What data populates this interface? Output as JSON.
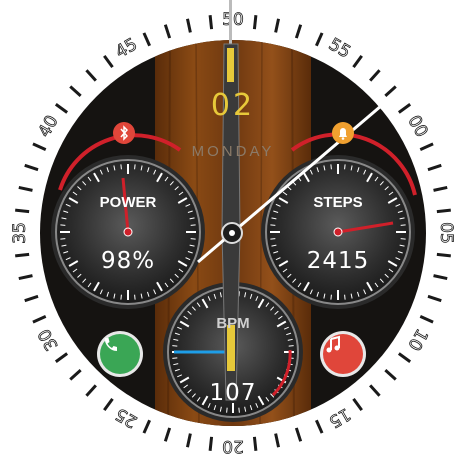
{
  "bezel": {
    "ring_numbers": [
      "50",
      "55",
      "00",
      "05",
      "10",
      "15",
      "20",
      "25",
      "30",
      "35",
      "40",
      "45"
    ]
  },
  "date": {
    "day_number": "02",
    "weekday": "MONDAY"
  },
  "subdials": {
    "power": {
      "title": "POWER",
      "value": "98%"
    },
    "steps": {
      "title": "STEPS",
      "value": "2415"
    },
    "bpm": {
      "title": "BPM",
      "value": "107"
    }
  },
  "indicators": {
    "bluetooth_icon": "bluetooth-icon",
    "alarm_icon": "bell-icon",
    "phone_icon": "phone-icon",
    "music_icon": "music-note-icon"
  },
  "colors": {
    "accent_red": "#d0202a",
    "accent_yellow": "#e7c93a",
    "phone_green": "#3aa655",
    "music_red": "#e0463a",
    "alarm_orange": "#f0a030",
    "bpm_blue": "#1e9ee8",
    "wood": "#7a3e10"
  }
}
